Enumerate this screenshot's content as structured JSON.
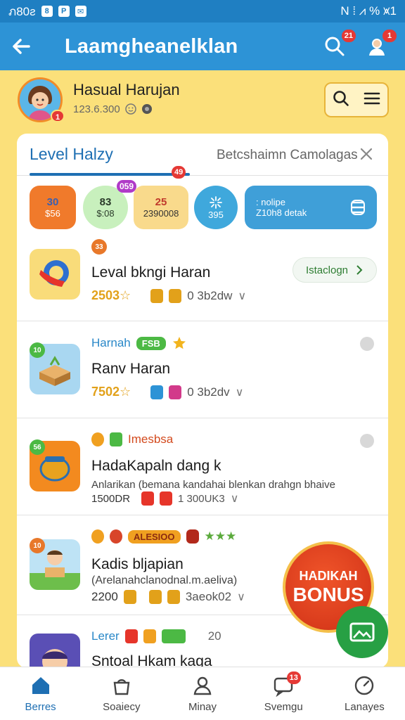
{
  "status_bar": {
    "left_text": "ภ80ƨ",
    "icons": [
      "8",
      "P",
      "✉"
    ],
    "right_text": "N ⁞ ⩘ % ⩙1"
  },
  "app_bar": {
    "title": "Laamgheanelklan",
    "search_badge": "21",
    "profile_badge": "1"
  },
  "profile": {
    "name": "Hasual Harujan",
    "subtitle": "123.6.300",
    "avatar_badge": "1"
  },
  "tabs": {
    "active": "Level Halzy",
    "tab_badge": "49",
    "right": "Betcshaimn Camolagas"
  },
  "chips": [
    {
      "line1": "30",
      "line2": "$56",
      "color": "#F07A2B"
    },
    {
      "line1": "83",
      "line2": "$:08",
      "badge": "059",
      "color": "#C8F0BD"
    },
    {
      "line1": "25",
      "line2": "2390008",
      "color": "#F9DA8C"
    },
    {
      "line1": "",
      "line2": "395",
      "color": "#3FA8DC"
    },
    {
      "line1": ": nolipe",
      "line2": "Z10h8 detak",
      "color": "#3F9FD8"
    }
  ],
  "rows": [
    {
      "badge": "33",
      "title": "Leval bkngi Haran",
      "score": "2503☆",
      "stat": "0 3b2dw",
      "action_label": "Istaclogn",
      "thumb_color": "#F9DC7A"
    },
    {
      "badge": "10",
      "tag_label": "Harnah",
      "tag_pill": "FSB",
      "title": "Ranv Haran",
      "score": "7502☆",
      "stat": "0 3b2dv",
      "thumb_color": "#A9D7F1"
    },
    {
      "badge": "56",
      "tag_label": "Imesbsa",
      "title": "HadaKapaln dang k",
      "description": "Anlarikan (bemana kandahai blenkan drahgn bhaive",
      "score": "1500DR",
      "stat": "1 300UK3",
      "thumb_color": "#F38A1F"
    },
    {
      "badge": "10",
      "tag_pill": "ALESIOO",
      "title": "Kadis bljapian",
      "description": "(Arelanahclanodnal.m.aeliva)",
      "score": "2200",
      "stat": "3aeok02",
      "thumb_color": "#BEE3F5"
    },
    {
      "tag_label": "Lerer",
      "count": "20",
      "title": "Sntoal Hkam kaga",
      "thumb_color": "#5A4FB5"
    }
  ],
  "bonus": {
    "line1": "HADIKAH",
    "line2": "BONUS"
  },
  "bottom_nav": [
    {
      "label": "Berres",
      "icon": "home-icon",
      "active": true
    },
    {
      "label": "Soaiecy",
      "icon": "bag-icon"
    },
    {
      "label": "Minay",
      "icon": "person-icon"
    },
    {
      "label": "Svemgu",
      "icon": "chat-icon",
      "badge": "13"
    },
    {
      "label": "Lanayes",
      "icon": "gauge-icon"
    }
  ],
  "colors": {
    "primary": "#2D93D6",
    "status_bar": "#1F7FC2",
    "background": "#FBE07A",
    "accent": "#E8782A",
    "badge": "#E53935"
  }
}
